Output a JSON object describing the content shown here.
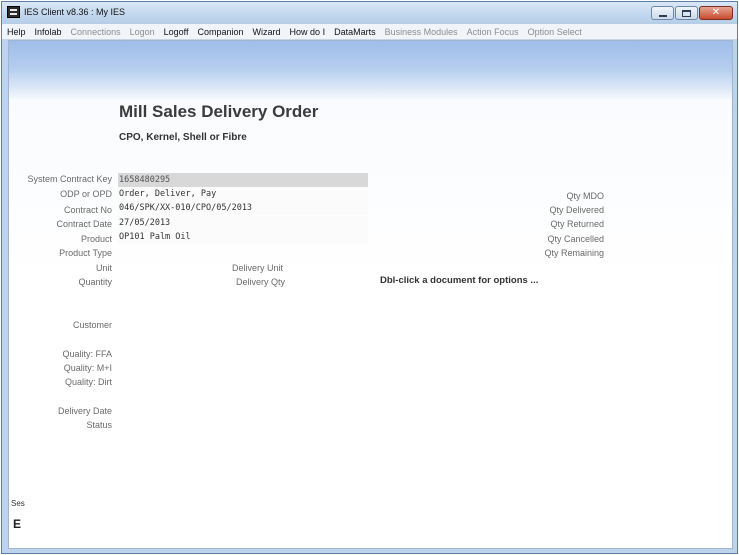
{
  "window": {
    "title": "IES Client v8.36 : My IES",
    "controls": {
      "minimize": "minimize",
      "maximize": "maximize",
      "close": "✕"
    }
  },
  "menu": {
    "items": [
      {
        "label": "Help",
        "enabled": true
      },
      {
        "label": "Infolab",
        "enabled": true
      },
      {
        "label": "Connections",
        "enabled": false
      },
      {
        "label": "Logon",
        "enabled": false
      },
      {
        "label": "Logoff",
        "enabled": true
      },
      {
        "label": "Companion",
        "enabled": true
      },
      {
        "label": "Wizard",
        "enabled": true
      },
      {
        "label": "How do I",
        "enabled": true
      },
      {
        "label": "DataMarts",
        "enabled": true
      },
      {
        "label": "Business Modules",
        "enabled": false
      },
      {
        "label": "Action Focus",
        "enabled": false
      },
      {
        "label": "Option Select",
        "enabled": false
      }
    ]
  },
  "page": {
    "title": "Mill Sales Delivery Order",
    "subtitle": "CPO, Kernel, Shell or Fibre",
    "hint": "Dbl-click a document for options ..."
  },
  "labels": {
    "system_contract_key": "System Contract Key",
    "odp_or_opd": "ODP or OPD",
    "contract_no": "Contract No",
    "contract_date": "Contract Date",
    "product": "Product",
    "product_type": "Product Type",
    "unit": "Unit",
    "quantity": "Quantity",
    "customer": "Customer",
    "quality_ffa": "Quality: FFA",
    "quality_mi": "Quality: M+I",
    "quality_dirt": "Quality: Dirt",
    "delivery_date": "Delivery Date",
    "status": "Status",
    "delivery_unit": "Delivery Unit",
    "delivery_qty": "Delivery Qty",
    "qty_mdo": "Qty MDO",
    "qty_delivered": "Qty Delivered",
    "qty_returned": "Qty Returned",
    "qty_cancelled": "Qty Cancelled",
    "qty_remaining": "Qty Remaining"
  },
  "values": {
    "system_contract_key": "1658480295",
    "odp_or_opd": "Order, Deliver, Pay",
    "contract_no": "046/SPK/XX-010/CPO/05/2013",
    "contract_date": "27/05/2013",
    "product": "OP101 Palm Oil"
  },
  "side_strip": {
    "label": "Ses",
    "glyph": "E"
  }
}
